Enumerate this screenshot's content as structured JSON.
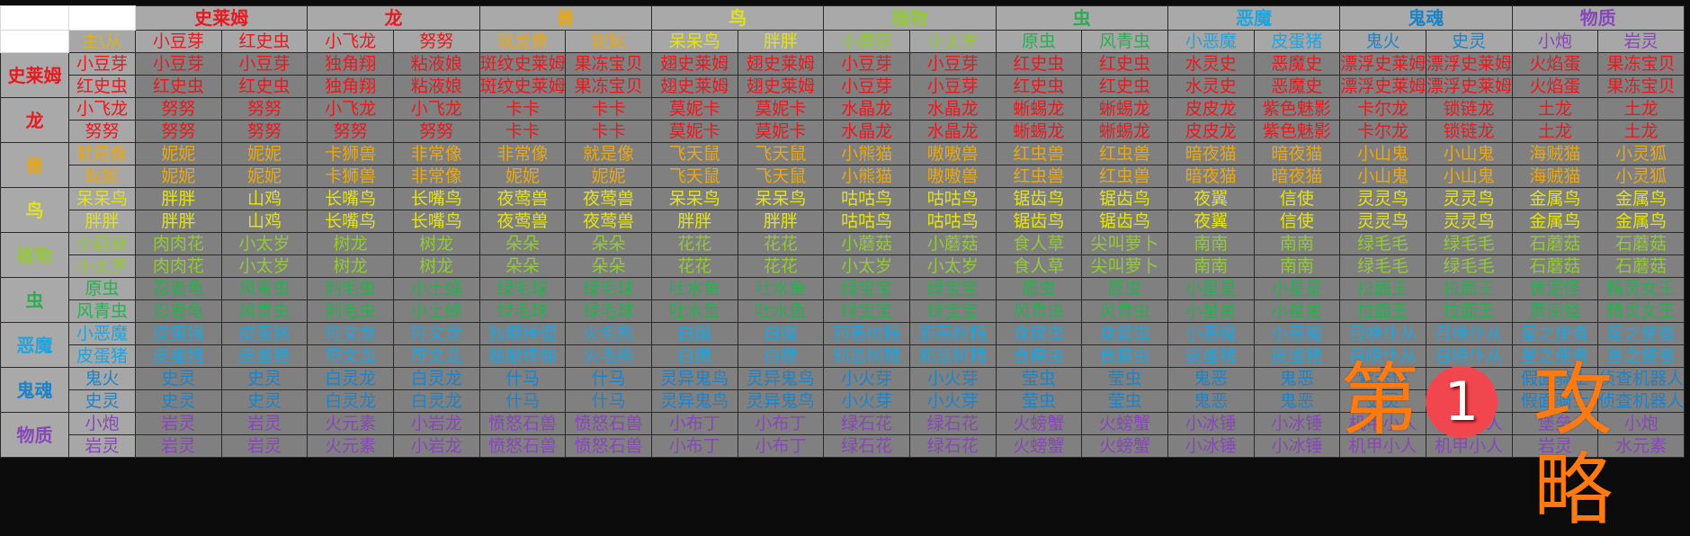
{
  "title_corner": "主\\从",
  "colors": {
    "史莱姆": "#e8191f",
    "龙": "#e8191f",
    "兽": "#e6a817",
    "鸟": "#e2e21a",
    "植物": "#93c83a",
    "虫": "#27b04f",
    "恶魔": "#20a4de",
    "鬼魂": "#1d83c8",
    "物质": "#8747b6",
    "corner": "#d9b51a"
  },
  "groups": [
    {
      "name": "史莱姆",
      "members": [
        "小豆芽",
        "红史虫"
      ]
    },
    {
      "name": "龙",
      "members": [
        "小飞龙",
        "努努"
      ]
    },
    {
      "name": "兽",
      "members": [
        "就是像",
        "妮妮"
      ]
    },
    {
      "name": "鸟",
      "members": [
        "呆呆鸟",
        "胖胖"
      ]
    },
    {
      "name": "植物",
      "members": [
        "小蘑菇",
        "小太岁"
      ]
    },
    {
      "name": "虫",
      "members": [
        "原虫",
        "风青虫"
      ]
    },
    {
      "name": "恶魔",
      "members": [
        "小恶魔",
        "皮蛋猪"
      ]
    },
    {
      "name": "鬼魂",
      "members": [
        "鬼火",
        "史灵"
      ]
    },
    {
      "name": "物质",
      "members": [
        "小炮",
        "岩灵"
      ]
    }
  ],
  "rows": [
    {
      "group": 0,
      "member": 0,
      "cells": [
        "小豆芽",
        "小豆芽",
        "独角翔",
        "粘液娘",
        "斑纹史莱姆",
        "果冻宝贝",
        "翅史莱姆",
        "翅史莱姆",
        "小豆芽",
        "小豆芽",
        "红史虫",
        "红史虫",
        "水灵史",
        "恶魔史",
        "漂浮史莱姆",
        "漂浮史莱姆",
        "火焰蛋",
        "果冻宝贝"
      ]
    },
    {
      "group": 0,
      "member": 1,
      "cells": [
        "红史虫",
        "红史虫",
        "独角翔",
        "粘液娘",
        "斑纹史莱姆",
        "果冻宝贝",
        "翅史莱姆",
        "翅史莱姆",
        "小豆芽",
        "小豆芽",
        "红史虫",
        "红史虫",
        "水灵史",
        "恶魔史",
        "漂浮史莱姆",
        "漂浮史莱姆",
        "火焰蛋",
        "果冻宝贝"
      ]
    },
    {
      "group": 1,
      "member": 0,
      "cells": [
        "努努",
        "努努",
        "小飞龙",
        "小飞龙",
        "卡卡",
        "卡卡",
        "莫妮卡",
        "莫妮卡",
        "水晶龙",
        "水晶龙",
        "蜥蜴龙",
        "蜥蜴龙",
        "皮皮龙",
        "紫色魅影",
        "卡尔龙",
        "锁链龙",
        "土龙",
        "土龙"
      ]
    },
    {
      "group": 1,
      "member": 1,
      "cells": [
        "努努",
        "努努",
        "努努",
        "努努",
        "卡卡",
        "卡卡",
        "莫妮卡",
        "莫妮卡",
        "水晶龙",
        "水晶龙",
        "蜥蜴龙",
        "蜥蜴龙",
        "皮皮龙",
        "紫色魅影",
        "卡尔龙",
        "锁链龙",
        "土龙",
        "土龙"
      ]
    },
    {
      "group": 2,
      "member": 0,
      "cells": [
        "妮妮",
        "妮妮",
        "卡狮兽",
        "非常像",
        "非常像",
        "就是像",
        "飞天鼠",
        "飞天鼠",
        "小熊猫",
        "嗷嗷兽",
        "红虫兽",
        "红虫兽",
        "暗夜猫",
        "暗夜猫",
        "小山鬼",
        "小山鬼",
        "海贼猫",
        "小灵狐"
      ]
    },
    {
      "group": 2,
      "member": 1,
      "cells": [
        "妮妮",
        "妮妮",
        "卡狮兽",
        "非常像",
        "妮妮",
        "妮妮",
        "飞天鼠",
        "飞天鼠",
        "小熊猫",
        "嗷嗷兽",
        "红虫兽",
        "红虫兽",
        "暗夜猫",
        "暗夜猫",
        "小山鬼",
        "小山鬼",
        "海贼猫",
        "小灵狐"
      ]
    },
    {
      "group": 3,
      "member": 0,
      "cells": [
        "胖胖",
        "山鸡",
        "长嘴鸟",
        "长嘴鸟",
        "夜莺兽",
        "夜莺兽",
        "呆呆鸟",
        "呆呆鸟",
        "咕咕鸟",
        "咕咕鸟",
        "锯齿鸟",
        "锯齿鸟",
        "夜翼",
        "信使",
        "灵灵鸟",
        "灵灵鸟",
        "金属鸟",
        "金属鸟"
      ]
    },
    {
      "group": 3,
      "member": 1,
      "cells": [
        "胖胖",
        "山鸡",
        "长嘴鸟",
        "长嘴鸟",
        "夜莺兽",
        "夜莺兽",
        "胖胖",
        "胖胖",
        "咕咕鸟",
        "咕咕鸟",
        "锯齿鸟",
        "锯齿鸟",
        "夜翼",
        "信使",
        "灵灵鸟",
        "灵灵鸟",
        "金属鸟",
        "金属鸟"
      ]
    },
    {
      "group": 4,
      "member": 0,
      "cells": [
        "肉肉花",
        "小太岁",
        "树龙",
        "树龙",
        "朵朵",
        "朵朵",
        "花花",
        "花花",
        "小蘑菇",
        "小蘑菇",
        "食人草",
        "尖叫萝卜",
        "南南",
        "南南",
        "绿毛毛",
        "绿毛毛",
        "石蘑菇",
        "石蘑菇"
      ]
    },
    {
      "group": 4,
      "member": 1,
      "cells": [
        "肉肉花",
        "小太岁",
        "树龙",
        "树龙",
        "朵朵",
        "朵朵",
        "花花",
        "花花",
        "小太岁",
        "小太岁",
        "食人草",
        "尖叫萝卜",
        "南南",
        "南南",
        "绿毛毛",
        "绿毛毛",
        "石蘑菇",
        "石蘑菇"
      ]
    },
    {
      "group": 5,
      "member": 0,
      "cells": [
        "忍者龟",
        "风青虫",
        "刺毛虫",
        "小土蛹",
        "绿毛球",
        "绿毛球",
        "吐水鱼",
        "吐水鱼",
        "绿宝宝",
        "绿宝宝",
        "原虫",
        "原虫",
        "小星星",
        "小星星",
        "拉面王",
        "拉面王",
        "黄泥怪",
        "精灵女王"
      ]
    },
    {
      "group": 5,
      "member": 1,
      "cells": [
        "忍者龟",
        "风青虫",
        "刺毛虫",
        "小土蛹",
        "绿毛球",
        "绿毛球",
        "吐水鱼",
        "吐水鱼",
        "绿宝宝",
        "绿宝宝",
        "风青虫",
        "风青虫",
        "小星星",
        "小星星",
        "拉面王",
        "拉面王",
        "黄泥怪",
        "精灵女王"
      ]
    },
    {
      "group": 6,
      "member": 0,
      "cells": [
        "皮蛋猪",
        "皮蛋猪",
        "符文龙",
        "符文龙",
        "独眼棒棚",
        "火毛熊",
        "白魔",
        "白魔",
        "邪恶树精",
        "邪恶树精",
        "食腐虫",
        "食腐虫",
        "小恶魔",
        "小恶魔",
        "召唤仆从",
        "召唤仆从",
        "星之使者",
        "星之使者"
      ]
    },
    {
      "group": 6,
      "member": 1,
      "cells": [
        "皮蛋猪",
        "皮蛋猪",
        "符文龙",
        "符文龙",
        "独眼棒棚",
        "火毛熊",
        "白魔",
        "白魔",
        "邪恶树精",
        "邪恶树精",
        "食腐虫",
        "食腐虫",
        "皮蛋猪",
        "皮蛋猪",
        "召唤仆从",
        "召唤仆从",
        "星之使者",
        "星之使者"
      ]
    },
    {
      "group": 7,
      "member": 0,
      "cells": [
        "史灵",
        "史灵",
        "白灵龙",
        "白灵龙",
        "什马",
        "什马",
        "灵异鬼鸟",
        "灵异鬼鸟",
        "小火芽",
        "小火芽",
        "莹虫",
        "莹虫",
        "鬼恶",
        "鬼恶",
        "紫云怪",
        "鬼火",
        "假面骑士",
        "侦查机器人"
      ]
    },
    {
      "group": 7,
      "member": 1,
      "cells": [
        "史灵",
        "史灵",
        "白灵龙",
        "白灵龙",
        "什马",
        "什马",
        "灵异鬼鸟",
        "灵异鬼鸟",
        "小火芽",
        "小火芽",
        "莹虫",
        "莹虫",
        "鬼恶",
        "鬼恶",
        "史灵",
        "紫云怪",
        "假面骑士",
        "侦查机器人"
      ]
    },
    {
      "group": 8,
      "member": 0,
      "cells": [
        "岩灵",
        "岩灵",
        "火元素",
        "小岩龙",
        "愤怒石兽",
        "愤怒石兽",
        "小布丁",
        "小布丁",
        "绿石花",
        "绿石花",
        "火螃蟹",
        "火螃蟹",
        "小冰锤",
        "小冰锤",
        "机甲小人",
        "机甲小人",
        "堡垒",
        "小炮"
      ]
    },
    {
      "group": 8,
      "member": 1,
      "cells": [
        "岩灵",
        "岩灵",
        "火元素",
        "小岩龙",
        "愤怒石兽",
        "愤怒石兽",
        "小布丁",
        "小布丁",
        "绿石花",
        "绿石花",
        "火螃蟹",
        "火螃蟹",
        "小冰锤",
        "小冰锤",
        "机甲小人",
        "机甲小人",
        "岩灵",
        "水元素"
      ]
    }
  ],
  "watermark": {
    "left": "第",
    "badge": "1",
    "right": "攻略"
  }
}
